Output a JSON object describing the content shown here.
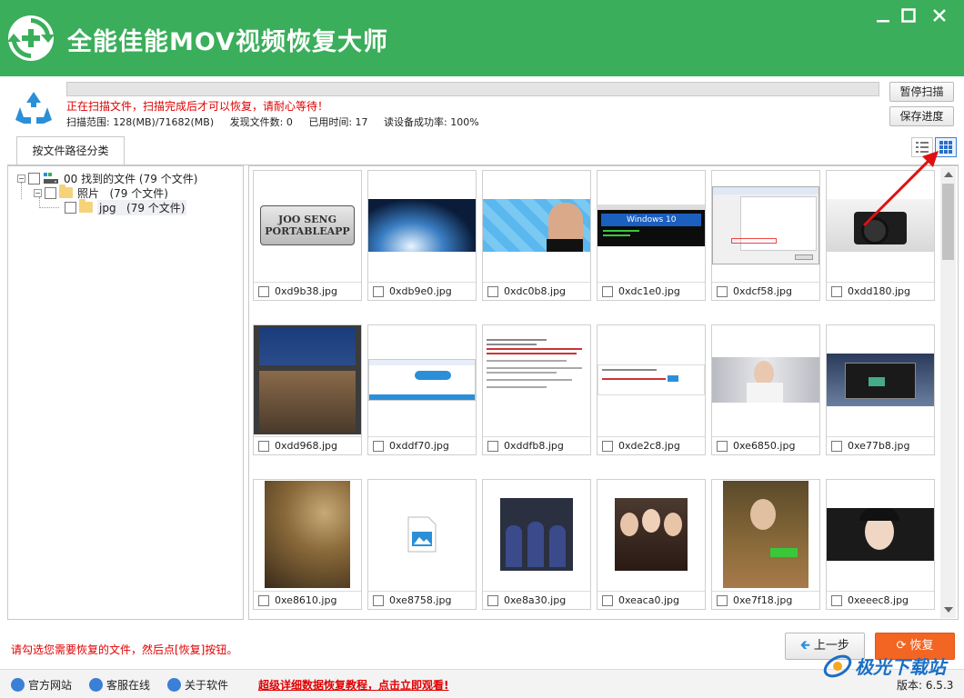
{
  "app": {
    "title": "全能佳能MOV视频恢复大师"
  },
  "window_controls": {
    "minimize": "minimize",
    "maximize": "maximize",
    "close": "close"
  },
  "scan": {
    "progress": 0,
    "message": "正在扫描文件，扫描完成后才可以恢复，请耐心等待！",
    "range": "扫描范围: 128(MB)/71682(MB)",
    "found": "发现文件数: 0",
    "elapsed": "已用时间: 17",
    "success_rate": "读设备成功率: 100%",
    "pause_label": "暂停扫描",
    "save_label": "保存进度"
  },
  "tabs": [
    {
      "label": "按文件路径分类",
      "active": true
    }
  ],
  "view_modes": [
    {
      "icon": "list-view-icon"
    },
    {
      "icon": "grid-view-icon",
      "active": true
    }
  ],
  "tree": [
    {
      "label": "00 找到的文件",
      "count": "(79 个文件)",
      "icon": "drive-icon"
    },
    {
      "label": "照片",
      "count": "(79 个文件)",
      "icon": "folder-icon"
    },
    {
      "label": "jpg",
      "count": "(79 个文件)",
      "icon": "folder-icon",
      "selected": true
    }
  ],
  "thumbnails": [
    {
      "name": "0xd9b38.jpg",
      "caption_in_image": "JOO SENG PORTABLEAPP",
      "image": "logo"
    },
    {
      "name": "0xdb9e0.jpg",
      "image": "satellite"
    },
    {
      "name": "0xdc0b8.jpg",
      "image": "portrait-twitter"
    },
    {
      "name": "0xdc1e0.jpg",
      "caption_in_image": "Windows 10",
      "image": "windows-terminal"
    },
    {
      "name": "0xdcf58.jpg",
      "image": "dialog"
    },
    {
      "name": "0xdd180.jpg",
      "image": "camera"
    },
    {
      "name": "0xdd968.jpg",
      "image": "video-meme"
    },
    {
      "name": "0xddf70.jpg",
      "image": "webpage"
    },
    {
      "name": "0xddfb8.jpg",
      "image": "document"
    },
    {
      "name": "0xde2c8.jpg",
      "image": "webpage-small"
    },
    {
      "name": "0xe6850.jpg",
      "image": "portrait"
    },
    {
      "name": "0xe77b8.jpg",
      "image": "desktop"
    },
    {
      "name": "0xe8610.jpg",
      "image": "map"
    },
    {
      "name": "0xe8758.jpg",
      "image": "placeholder"
    },
    {
      "name": "0xe8a30.jpg",
      "image": "astronauts"
    },
    {
      "name": "0xeaca0.jpg",
      "image": "group-photo"
    },
    {
      "name": "0xe7f18.jpg",
      "image": "painting"
    },
    {
      "name": "0xeeec8.jpg",
      "image": "portrait-woman"
    }
  ],
  "hint": "请勾选您需要恢复的文件，然后点[恢复]按钮。",
  "buttons": {
    "prev": "上一步",
    "recover": "恢复"
  },
  "footer": {
    "links": [
      "官方网站",
      "客服在线",
      "关于软件"
    ],
    "promo": "超级详细数据恢复教程，点击立即观看!",
    "version": "版本: 6.5.3"
  },
  "watermark": {
    "text": "极光下载站"
  },
  "colors": {
    "brand": "#3aae5a",
    "accent": "#f26522",
    "warning": "#e00000",
    "arrow": "#e01010"
  }
}
